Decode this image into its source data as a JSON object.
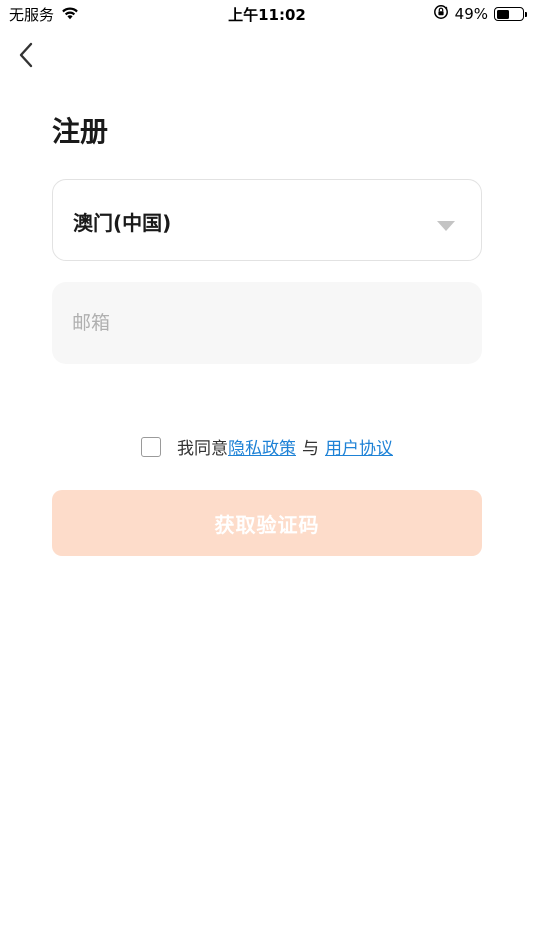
{
  "status_bar": {
    "carrier": "无服务",
    "time": "上午11:02",
    "battery_percent_text": "49%",
    "battery_level": 0.49
  },
  "icons": {
    "back": "chevron-left-icon",
    "wifi": "wifi-icon",
    "orientation_lock": "orientation-lock-icon",
    "battery": "battery-icon",
    "dropdown": "caret-down-icon"
  },
  "page": {
    "title": "注册"
  },
  "form": {
    "region": {
      "value": "澳门(中国)"
    },
    "email": {
      "placeholder": "邮箱",
      "value": ""
    },
    "agreement": {
      "prefix": "我同意",
      "privacy_link": "隐私政策",
      "separator": "与",
      "terms_link": "用户协议",
      "checked": false
    },
    "submit_label": "获取验证码"
  },
  "colors": {
    "link": "#1e82d6",
    "submit_bg_disabled": "#fddcca",
    "input_bg": "#f7f7f7",
    "border": "#e2e2e2"
  }
}
